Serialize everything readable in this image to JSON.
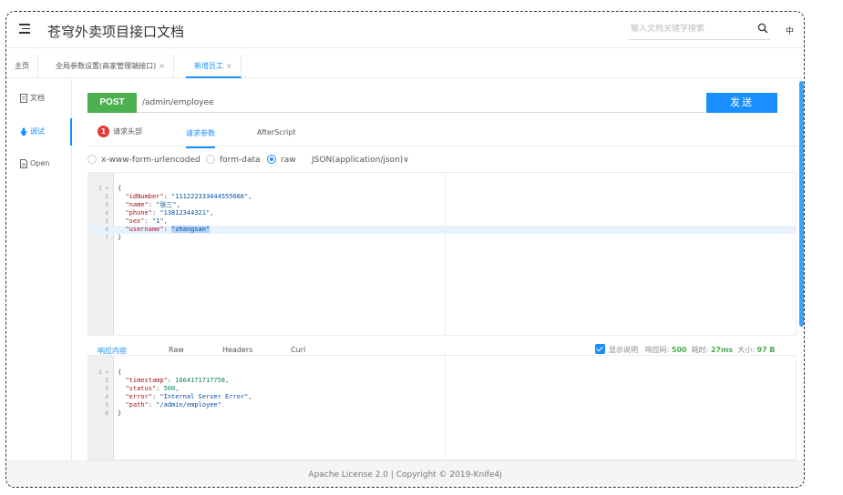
{
  "header": {
    "title": "苍穹外卖项目接口文档",
    "search_placeholder": "输入文档关键字搜索",
    "lang": "中"
  },
  "tabs": [
    {
      "label": "主页"
    },
    {
      "label": "全局参数设置(商家管理端接口)",
      "close": "×"
    },
    {
      "label": "新增员工",
      "close": "×"
    }
  ],
  "sidebar": {
    "items": [
      {
        "label": "文档",
        "icon": "document-icon"
      },
      {
        "label": "调试",
        "icon": "debug-icon"
      },
      {
        "label": "Open",
        "icon": "file-icon"
      }
    ]
  },
  "request": {
    "method": "POST",
    "url": "/admin/employee",
    "send_label": "发送",
    "subtabs": [
      {
        "badge": "1",
        "label": "请求头部"
      },
      {
        "label": "请求参数"
      },
      {
        "label": "AfterScript"
      }
    ],
    "body_types": [
      "x-www-form-urlencoded",
      "form-data",
      "raw"
    ],
    "content_type": "JSON(application/json)∨",
    "body_lines": [
      {
        "num": "1 ▾",
        "text": "{"
      },
      {
        "num": "2",
        "key": "\"idNumber\"",
        "val": "\"111222333444555666\"",
        "tail": ","
      },
      {
        "num": "3",
        "key": "\"name\"",
        "val": "\"张三\"",
        "tail": ","
      },
      {
        "num": "4",
        "key": "\"phone\"",
        "val": "\"13812344321\"",
        "tail": ","
      },
      {
        "num": "5",
        "key": "\"sex\"",
        "val": "\"1\"",
        "tail": ","
      },
      {
        "num": "6",
        "key": "\"username\"",
        "val": "\"zhangsan\"",
        "tail": ""
      },
      {
        "num": "7",
        "text": "}"
      }
    ]
  },
  "response": {
    "tabs": [
      "响应内容",
      "Raw",
      "Headers",
      "Curl"
    ],
    "show_desc_label": "显示说明",
    "status_label": "响应码:",
    "status_value": "500",
    "time_label": "耗时:",
    "time_value": "27ms",
    "size_label": "大小:",
    "size_value": "97 B",
    "body_lines": [
      {
        "num": "1 ▾",
        "text": "{"
      },
      {
        "num": "2",
        "key": "\"timestamp\"",
        "val": "1664171717758",
        "tail": ","
      },
      {
        "num": "3",
        "key": "\"status\"",
        "val": "500",
        "tail": ","
      },
      {
        "num": "4",
        "key": "\"error\"",
        "val": "\"Internal Server Error\"",
        "tail": ","
      },
      {
        "num": "5",
        "key": "\"path\"",
        "val": "\"/admin/employee\"",
        "tail": ""
      },
      {
        "num": "6",
        "text": "}"
      }
    ]
  },
  "footer": {
    "text": "Apache License 2.0 | Copyright © 2019-Knife4j"
  },
  "colors": {
    "accent": "#1890ff",
    "method": "#4caf50",
    "badge": "#e53935"
  }
}
